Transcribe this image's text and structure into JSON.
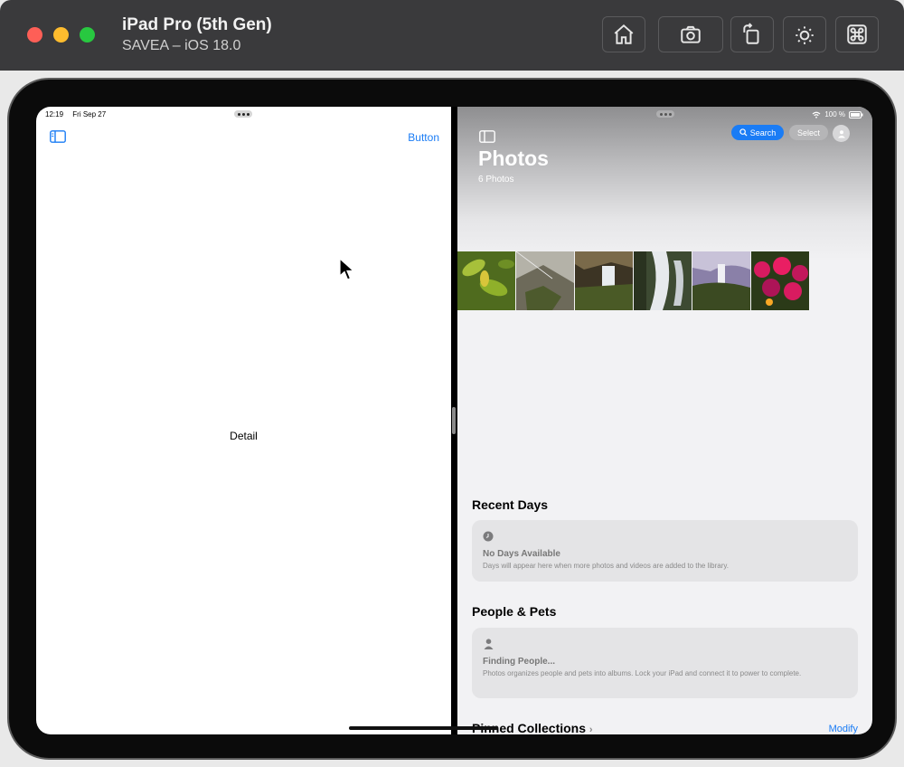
{
  "simulator": {
    "device_name": "iPad Pro (5th Gen)",
    "os_version": "SAVEA – iOS 18.0"
  },
  "left_app": {
    "status_time": "12:19",
    "status_date": "Fri Sep 27",
    "nav_button": "Button",
    "detail_label": "Detail"
  },
  "right_app": {
    "status_battery": "100 %",
    "search_label": "Search",
    "select_label": "Select",
    "title": "Photos",
    "photo_count": "6 Photos",
    "recent_days": {
      "title": "Recent Days",
      "empty_title": "No Days Available",
      "empty_desc": "Days will appear here when more photos and videos are added to the library."
    },
    "people_pets": {
      "title": "People & Pets",
      "empty_title": "Finding People...",
      "empty_desc": "Photos organizes people and pets into albums. Lock your iPad and connect it to power to complete."
    },
    "pinned": {
      "title": "Pinned Collections",
      "modify_label": "Modify"
    }
  },
  "colors": {
    "accent": "#1a7cf5",
    "titlebar": "#3a3a3c"
  },
  "photos": [
    {
      "name": "leaves",
      "color": "#6f8f2e"
    },
    {
      "name": "rocks",
      "color": "#8c8a7a"
    },
    {
      "name": "waterfall-1",
      "color": "#5a4a34"
    },
    {
      "name": "waterfall-2",
      "color": "#6f7276"
    },
    {
      "name": "waterfall-3",
      "color": "#6b6276"
    },
    {
      "name": "flowers",
      "color": "#c2185b"
    }
  ]
}
